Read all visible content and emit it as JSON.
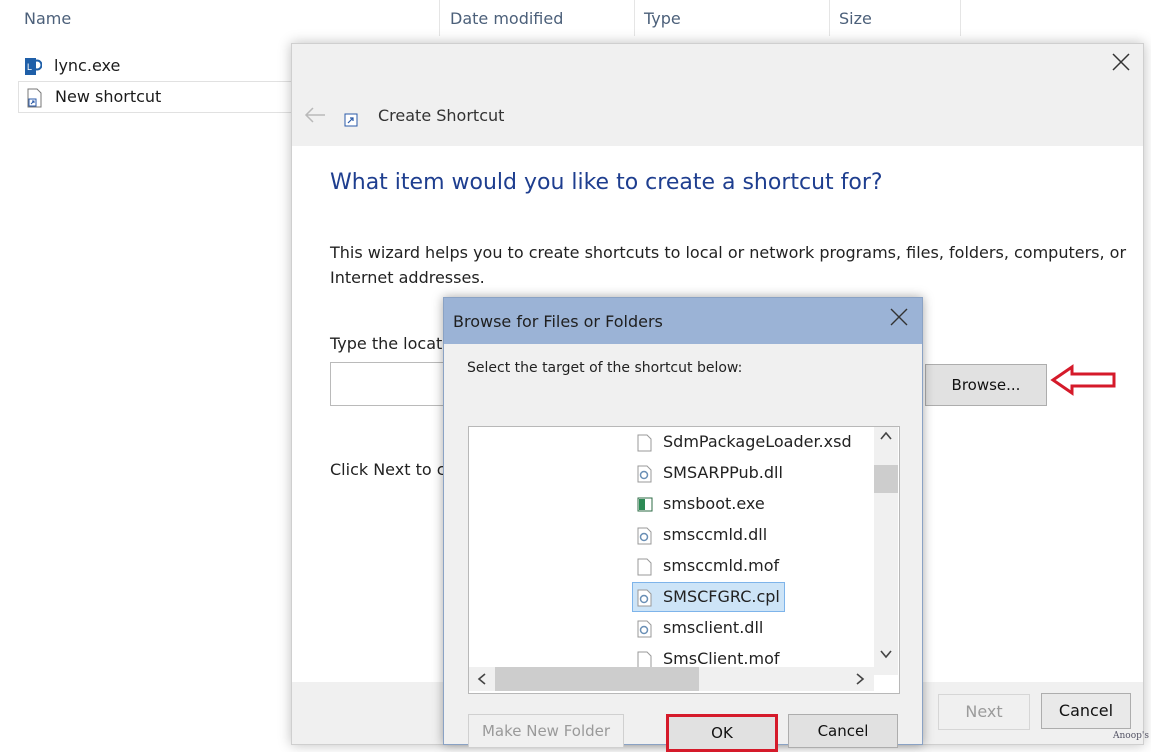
{
  "explorer": {
    "columns": [
      "Name",
      "Date modified",
      "Type",
      "Size"
    ],
    "files": [
      {
        "name": "lync.exe",
        "icon": "lync-app-icon"
      },
      {
        "name": "New shortcut",
        "icon": "shortcut-icon"
      }
    ]
  },
  "wizard": {
    "title": "Create Shortcut",
    "heading": "What item would you like to create a shortcut for?",
    "description": "This wizard helps you to create shortcuts to local or network programs, files, folders, computers, or Internet addresses.",
    "location_label": "Type the locati",
    "location_value": "",
    "browse_label": "Browse...",
    "click_next_text": "Click Next to c",
    "next_label": "Next",
    "cancel_label": "Cancel"
  },
  "browse_dialog": {
    "title": "Browse for Files or Folders",
    "instruction": "Select the target of the shortcut below:",
    "items": [
      {
        "name": "SdmPackageLoader.xsd",
        "icon": "file-icon"
      },
      {
        "name": "SMSARPPub.dll",
        "icon": "dll-icon"
      },
      {
        "name": "smsboot.exe",
        "icon": "exe-icon"
      },
      {
        "name": "smsccmld.dll",
        "icon": "dll-icon"
      },
      {
        "name": "smsccmld.mof",
        "icon": "file-icon"
      },
      {
        "name": "SMSCFGRC.cpl",
        "icon": "cpl-icon",
        "selected": true
      },
      {
        "name": "smsclient.dll",
        "icon": "dll-icon"
      },
      {
        "name": "SmsClient.mof",
        "icon": "file-icon"
      }
    ],
    "make_new_folder_label": "Make New Folder",
    "ok_label": "OK",
    "cancel_label": "Cancel"
  },
  "annotations": {
    "highlight_color": "#d51a2a"
  },
  "watermark": "Anoop's"
}
